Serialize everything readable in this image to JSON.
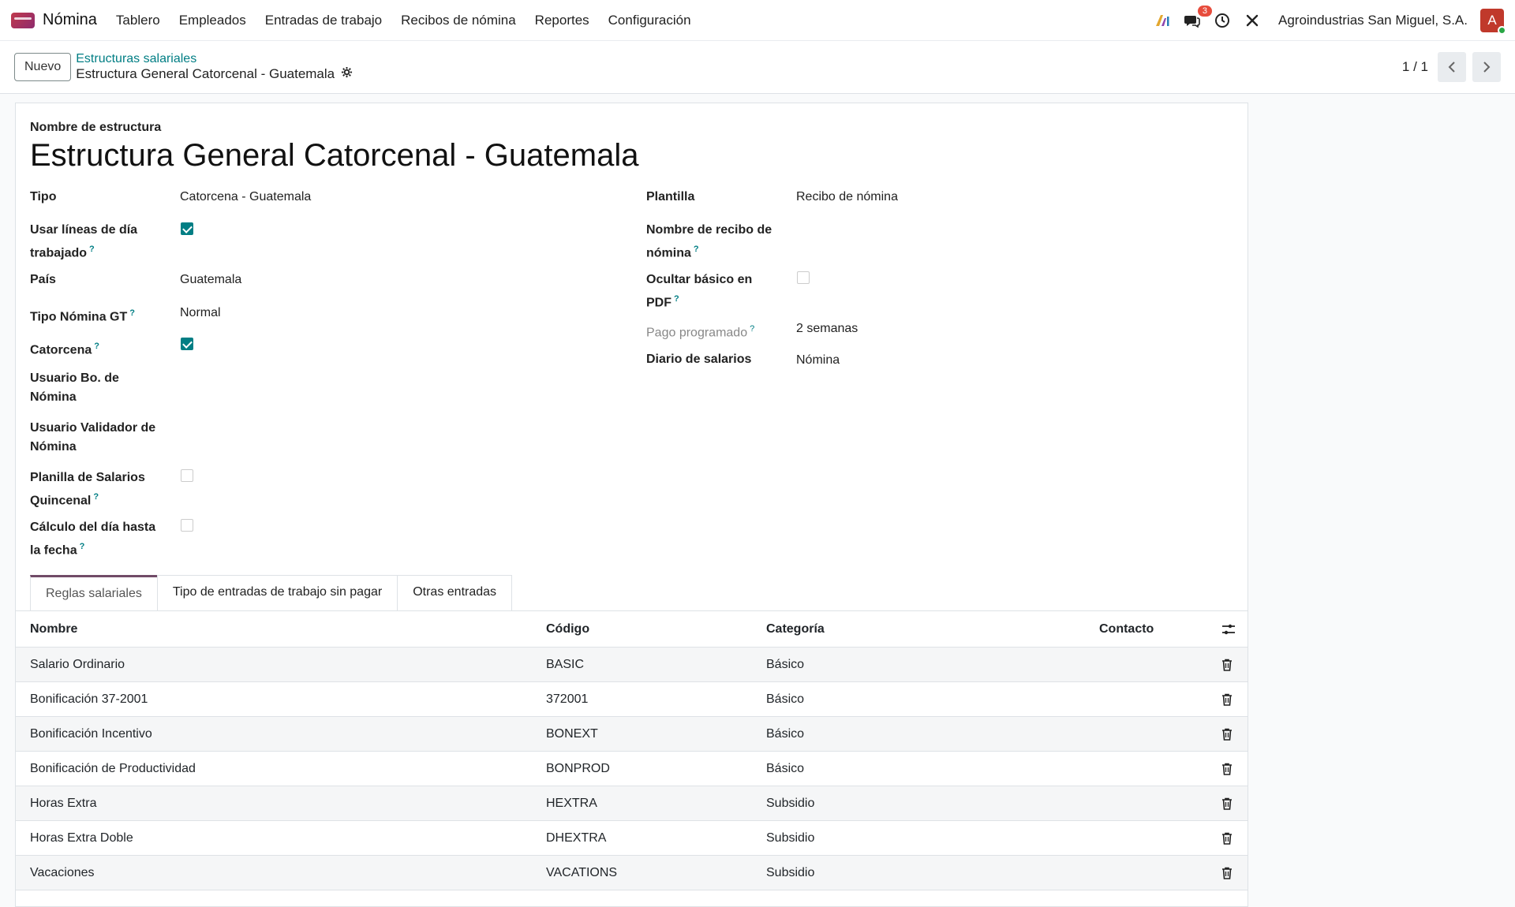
{
  "app": {
    "name": "Nómina",
    "menu": [
      "Tablero",
      "Empleados",
      "Entradas de trabajo",
      "Recibos de nómina",
      "Reportes",
      "Configuración"
    ],
    "messages_badge": "3",
    "company": "Agroindustrias San Miguel, S.A.",
    "avatar_letter": "A",
    "icons": [
      "ai-icon",
      "chat-icon",
      "clock-icon",
      "tools-icon"
    ]
  },
  "control": {
    "new_label": "Nuevo",
    "breadcrumb_parent": "Estructuras salariales",
    "breadcrumb_current": "Estructura General Catorcenal - Guatemala",
    "pager": "1 / 1"
  },
  "form": {
    "name_label": "Nombre de estructura",
    "name_value": "Estructura General Catorcenal - Guatemala",
    "left": {
      "tipo_label": "Tipo",
      "tipo_value": "Catorcena - Guatemala",
      "usar_lineas_label": "Usar líneas de día trabajado",
      "usar_lineas_checked": true,
      "pais_label": "País",
      "pais_value": "Guatemala",
      "tipo_nomina_label": "Tipo Nómina GT",
      "tipo_nomina_value": "Normal",
      "catorcena_label": "Catorcena",
      "catorcena_checked": true,
      "usuario_bo_label": "Usuario Bo. de Nómina",
      "usuario_validador_label": "Usuario Validador de Nómina",
      "planilla_label": "Planilla de Salarios Quincenal",
      "planilla_checked": false,
      "calculo_label": "Cálculo del día hasta la fecha",
      "calculo_checked": false
    },
    "right": {
      "plantilla_label": "Plantilla",
      "plantilla_value": "Recibo de nómina",
      "nombre_recibo_label": "Nombre de recibo de nómina",
      "ocultar_label": "Ocultar básico en PDF",
      "ocultar_checked": false,
      "pago_label": "Pago programado",
      "pago_value": "2 semanas",
      "diario_label": "Diario de salarios",
      "diario_value": "Nómina"
    },
    "help_mark": "?"
  },
  "tabs": [
    "Reglas salariales",
    "Tipo de entradas de trabajo sin pagar",
    "Otras entradas"
  ],
  "table": {
    "headers": {
      "name": "Nombre",
      "code": "Código",
      "category": "Categoría",
      "contact": "Contacto"
    },
    "rows": [
      {
        "name": "Salario Ordinario",
        "code": "BASIC",
        "category": "Básico"
      },
      {
        "name": "Bonificación 37-2001",
        "code": "372001",
        "category": "Básico"
      },
      {
        "name": "Bonificación Incentivo",
        "code": "BONEXT",
        "category": "Básico"
      },
      {
        "name": "Bonificación de Productividad",
        "code": "BONPROD",
        "category": "Básico"
      },
      {
        "name": "Horas Extra",
        "code": "HEXTRA",
        "category": "Subsidio"
      },
      {
        "name": "Horas Extra Doble",
        "code": "DHEXTRA",
        "category": "Subsidio"
      },
      {
        "name": "Vacaciones",
        "code": "VACATIONS",
        "category": "Subsidio"
      }
    ]
  }
}
